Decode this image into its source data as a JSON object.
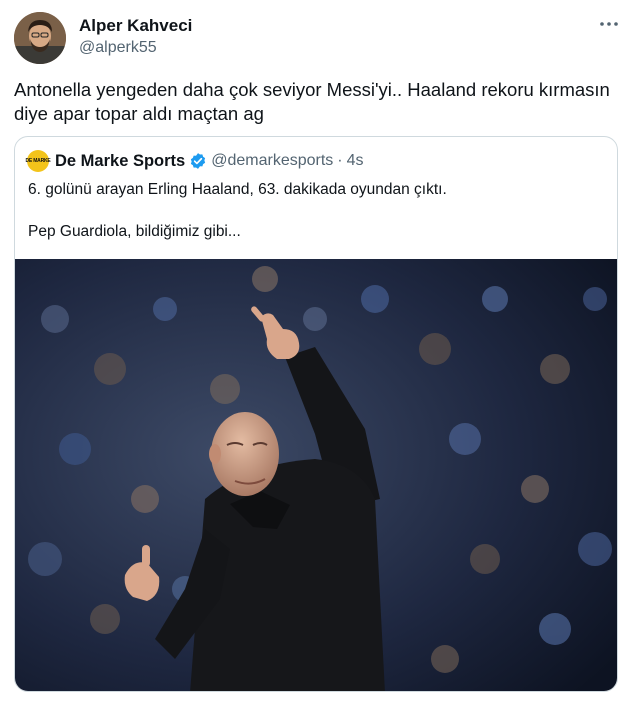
{
  "author": {
    "name": "Alper Kahveci",
    "handle": "@alperk55",
    "avatar_icon": "user-avatar"
  },
  "more_icon": "more-horizontal-icon",
  "tweet": {
    "text": "Antonella yengeden daha çok seviyor Messi'yi.. Haaland rekoru kırmasın\ndiye apar topar aldı maçtan ag"
  },
  "quoted": {
    "logo_text": "DE MARKE",
    "name": "De Marke Sports",
    "verified": true,
    "verified_color": "#1d9bf0",
    "handle": "@demarkesports",
    "separator": "·",
    "time": "4s",
    "text": "6. golünü arayan Erling Haaland, 63. dakikada oyundan çıktı.\n\nPep Guardiola, bildiğimiz gibi...",
    "media_icon": "photo-man-pointing"
  },
  "colors": {
    "text": "#0f1419",
    "secondary": "#536471",
    "border": "#cfd9de",
    "logo_bg": "#f3c41a"
  }
}
